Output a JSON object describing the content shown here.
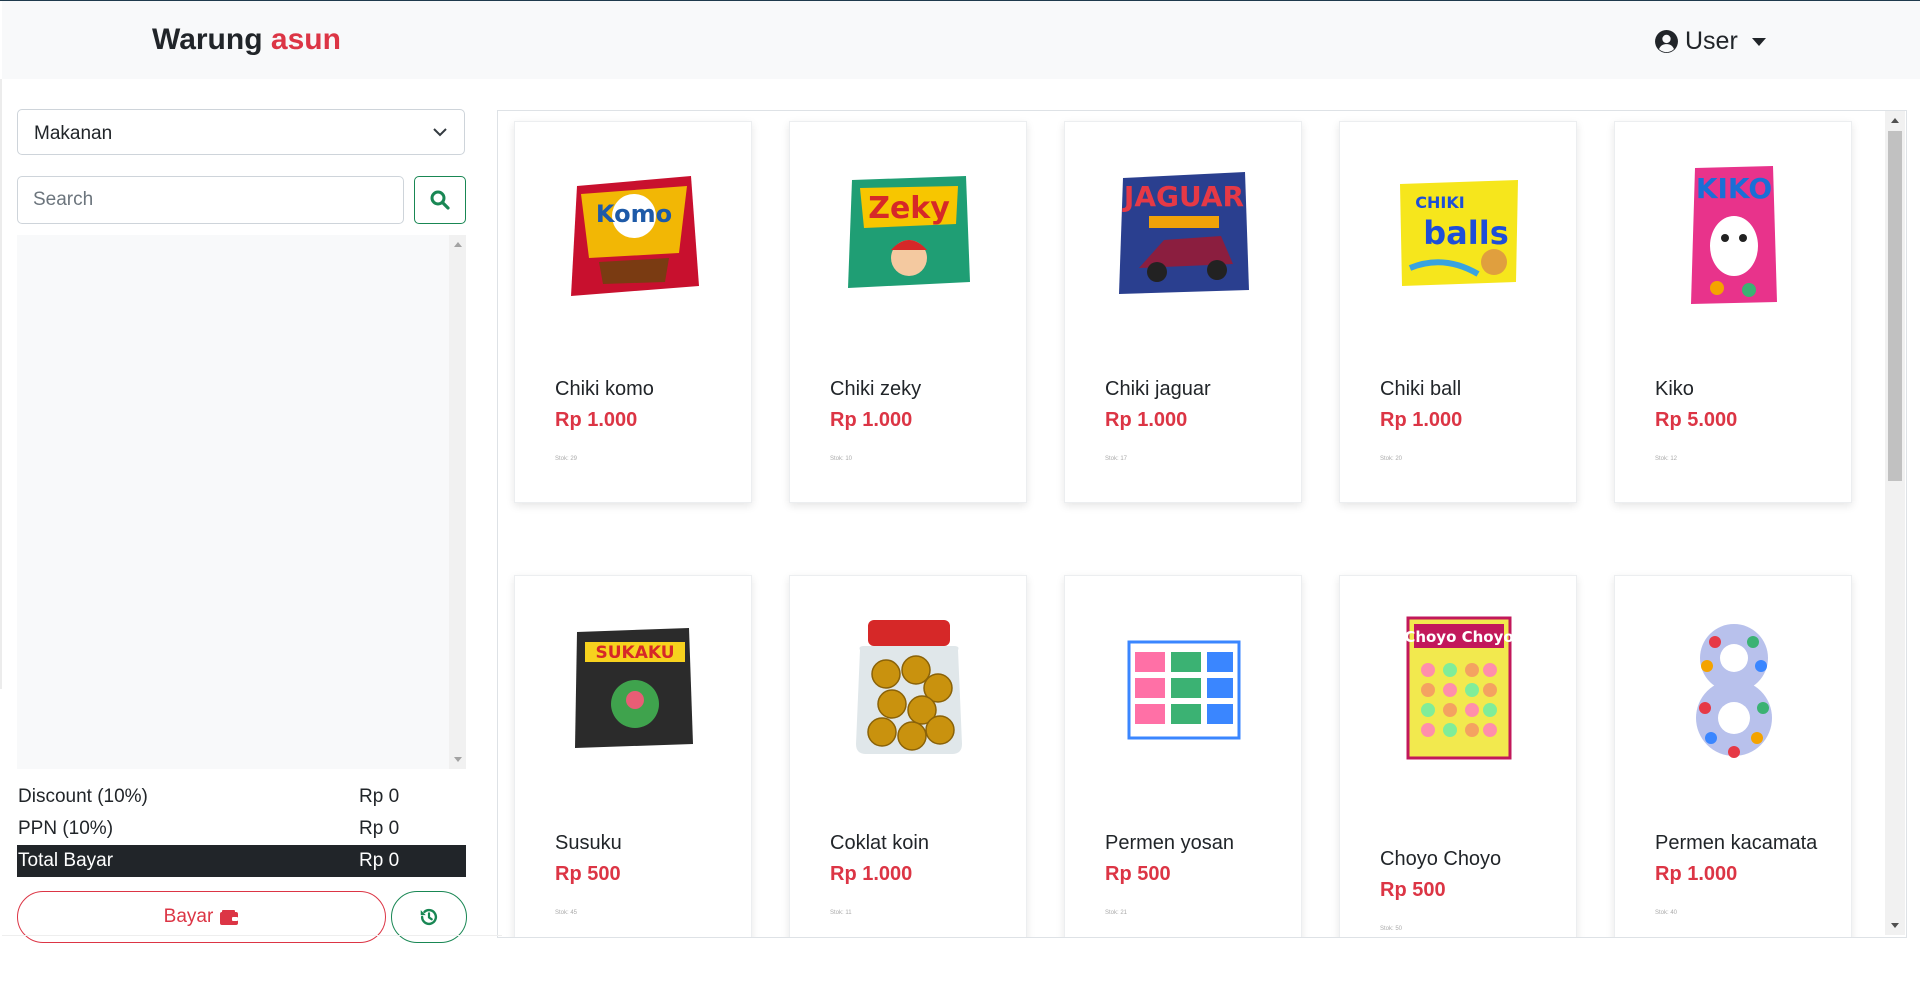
{
  "brand": {
    "name": "Warung",
    "accent": "asun"
  },
  "user_menu": {
    "label": "User"
  },
  "category_select": {
    "value": "Makanan"
  },
  "search": {
    "placeholder": "Search"
  },
  "totals": {
    "discount_label": "Discount (10%)",
    "discount_value": "Rp 0",
    "ppn_label": "PPN (10%)",
    "ppn_value": "Rp 0",
    "total_label": "Total Bayar",
    "total_value": "Rp 0"
  },
  "buttons": {
    "pay_label": "Bayar"
  },
  "colors": {
    "accent_red": "#dc3545",
    "accent_green": "#198754",
    "dark": "#212529"
  },
  "products": [
    {
      "name": "Chiki komo",
      "price": "Rp 1.000",
      "stock": "Stok: 29",
      "icon": "chiki-komo-image"
    },
    {
      "name": "Chiki zeky",
      "price": "Rp 1.000",
      "stock": "Stok: 10",
      "icon": "chiki-zeky-image"
    },
    {
      "name": "Chiki jaguar",
      "price": "Rp 1.000",
      "stock": "Stok: 17",
      "icon": "chiki-jaguar-image"
    },
    {
      "name": "Chiki ball",
      "price": "Rp 1.000",
      "stock": "Stok: 20",
      "icon": "chiki-ball-image"
    },
    {
      "name": "Kiko",
      "price": "Rp 5.000",
      "stock": "Stok: 12",
      "icon": "kiko-image"
    },
    {
      "name": "Susuku",
      "price": "Rp 500",
      "stock": "Stok: 45",
      "icon": "susuku-image"
    },
    {
      "name": "Coklat koin",
      "price": "Rp 1.000",
      "stock": "Stok: 11",
      "icon": "coklat-koin-image"
    },
    {
      "name": "Permen yosan",
      "price": "Rp 500",
      "stock": "Stok: 21",
      "icon": "permen-yosan-image"
    },
    {
      "name": "Choyo Choyo",
      "price": "Rp 500",
      "stock": "Stok: 50",
      "icon": "choyo-choyo-image"
    },
    {
      "name": "Permen kacamata",
      "price": "Rp 1.000",
      "stock": "Stok: 40",
      "icon": "permen-kacamata-image"
    }
  ]
}
